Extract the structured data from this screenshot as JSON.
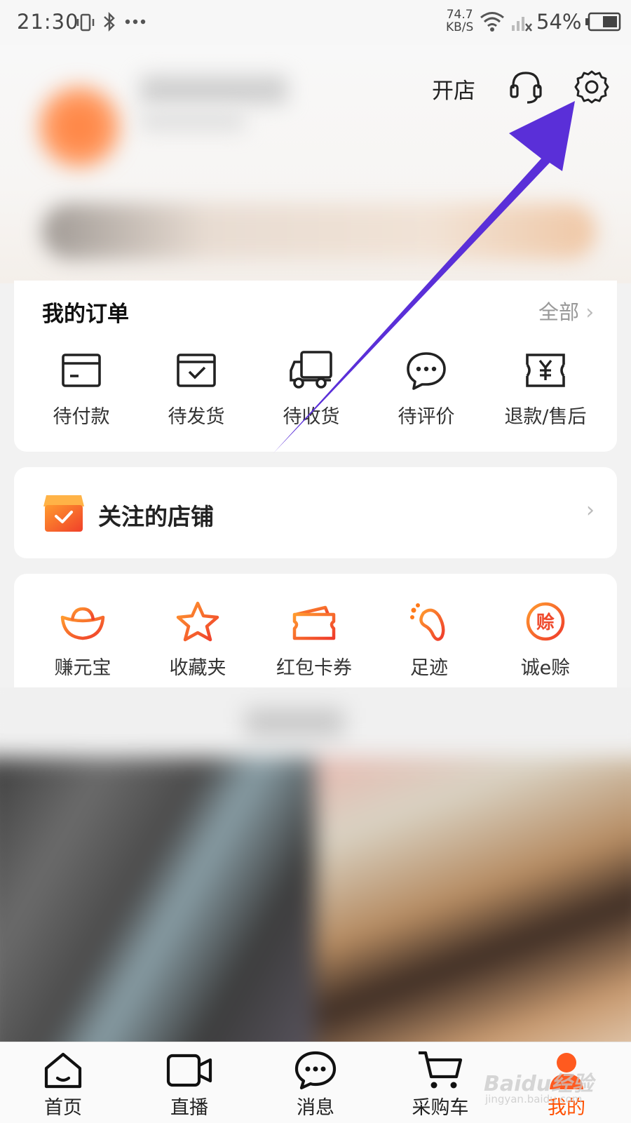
{
  "status_bar": {
    "time": "21:30",
    "network_speed_value": "74.7",
    "network_speed_unit": "KB/S",
    "battery": "54%"
  },
  "header": {
    "open_shop": "开店"
  },
  "orders": {
    "title": "我的订单",
    "view_all": "全部",
    "items": [
      {
        "label": "待付款",
        "icon": "wallet-card-icon"
      },
      {
        "label": "待发货",
        "icon": "package-check-icon"
      },
      {
        "label": "待收货",
        "icon": "delivery-truck-icon"
      },
      {
        "label": "待评价",
        "icon": "comment-bubble-icon"
      },
      {
        "label": "退款/售后",
        "icon": "refund-yen-icon"
      }
    ]
  },
  "followed_shops": {
    "title": "关注的店铺"
  },
  "tools": {
    "items": [
      {
        "label": "赚元宝",
        "icon": "gold-ingot-icon"
      },
      {
        "label": "收藏夹",
        "icon": "star-icon"
      },
      {
        "label": "红包卡券",
        "icon": "coupon-ticket-icon"
      },
      {
        "label": "足迹",
        "icon": "footprint-icon"
      },
      {
        "label": "诚e赊",
        "icon": "credit-badge-icon",
        "badge_char": "赊"
      }
    ]
  },
  "bottom_nav": {
    "items": [
      {
        "label": "首页",
        "icon": "home-icon"
      },
      {
        "label": "直播",
        "icon": "video-camera-icon"
      },
      {
        "label": "消息",
        "icon": "message-bubble-icon"
      },
      {
        "label": "采购车",
        "icon": "shopping-cart-icon"
      },
      {
        "label": "我的",
        "icon": "person-icon",
        "active": true
      }
    ]
  },
  "watermark": {
    "text": "Baidu经验",
    "sub": "jingyan.baidu.com"
  },
  "colors": {
    "accent": "#ff5000",
    "arrow": "#5a2fd8",
    "icon_red": "#e8412c",
    "icon_orange": "#ff7a1a"
  }
}
